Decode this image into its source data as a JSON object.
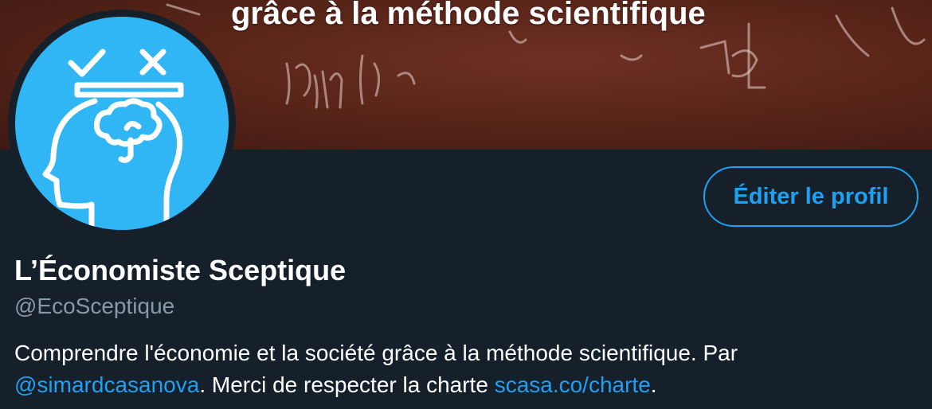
{
  "banner": {
    "text": "grâce à la méthode scientifique"
  },
  "profile": {
    "display_name": "L’Économiste Sceptique",
    "handle": "@EcoSceptique",
    "edit_button_label": "Éditer le profil"
  },
  "bio": {
    "part1": "Comprendre l'économie et la société grâce à la méthode scientifique. Par",
    "mention": "@simardcasanova",
    "part2": ". Merci de respecter la charte ",
    "link": "scasa.co/charte",
    "part3": "."
  },
  "colors": {
    "background": "#15202b",
    "accent": "#1da1f2",
    "avatar_bg": "#30b6f5",
    "secondary_text": "#8899a6"
  },
  "icons": {
    "avatar": "head-with-brain-check-cross-icon"
  }
}
